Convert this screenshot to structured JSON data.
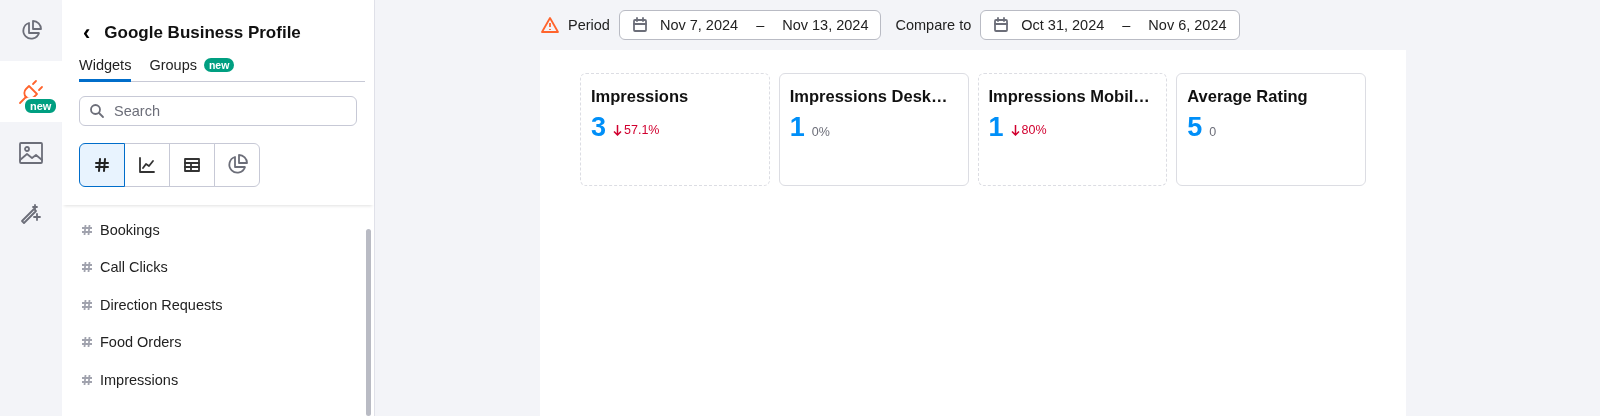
{
  "rail": [
    {
      "kind": "pie",
      "selected": false
    },
    {
      "kind": "plug",
      "selected": true,
      "badge": "new"
    },
    {
      "kind": "image",
      "selected": false
    },
    {
      "kind": "wand",
      "selected": false
    }
  ],
  "sidebar": {
    "back": "‹",
    "title": "Google Business Profile",
    "tabs": [
      {
        "label": "Widgets",
        "selected": true
      },
      {
        "label": "Groups",
        "selected": false,
        "badge": "new"
      }
    ],
    "search": {
      "placeholder": "Search"
    },
    "type_buttons": [
      {
        "kind": "hash",
        "selected": true
      },
      {
        "kind": "line",
        "selected": false
      },
      {
        "kind": "table",
        "selected": false
      },
      {
        "kind": "pie",
        "selected": false
      }
    ],
    "items": [
      {
        "label": "Bookings"
      },
      {
        "label": "Call Clicks"
      },
      {
        "label": "Direction Requests"
      },
      {
        "label": "Food Orders"
      },
      {
        "label": "Impressions"
      }
    ]
  },
  "header": {
    "period_label": "Period",
    "period_start": "Nov 7, 2024",
    "period_end": "Nov 13, 2024",
    "compare_label": "Compare to",
    "compare_start": "Oct 31, 2024",
    "compare_end": "Nov 6, 2024",
    "dash": "–"
  },
  "cards": [
    {
      "title": "Impressions",
      "value": "3",
      "delta": "57.1%",
      "kind": "down",
      "dashed": true
    },
    {
      "title": "Impressions Desk…",
      "value": "1",
      "delta": "0%",
      "kind": "flat",
      "dashed": false
    },
    {
      "title": "Impressions Mobil…",
      "value": "1",
      "delta": "80%",
      "kind": "down",
      "dashed": true
    },
    {
      "title": "Average Rating",
      "value": "5",
      "delta": "0",
      "kind": "flat",
      "dashed": false
    }
  ]
}
